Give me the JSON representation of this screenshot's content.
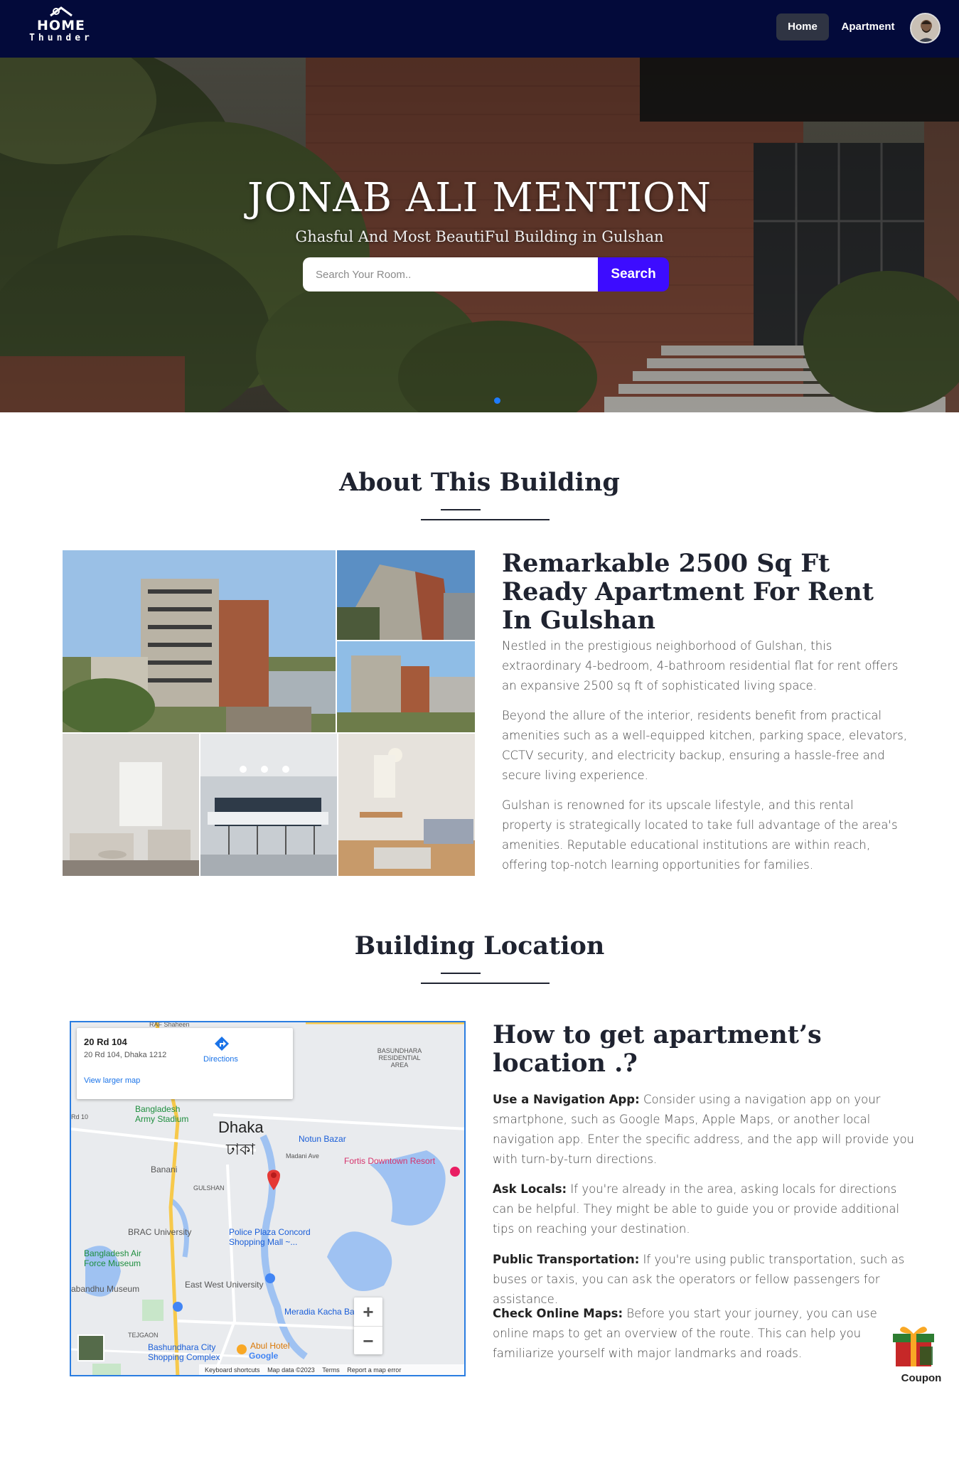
{
  "brand": {
    "logo_word": "HOME",
    "logo_sub": "Thunder"
  },
  "nav": {
    "home_label": "Home",
    "apartment_label": "Apartment"
  },
  "hero": {
    "title": "JONAB ALI MENTION",
    "subtitle": "Ghasful And Most BeautiFul Building in Gulshan",
    "search_placeholder": "Search Your Room..",
    "search_button": "Search",
    "carousel_active_index": 1,
    "carousel_count": 1
  },
  "about": {
    "section_title": "About This Building",
    "heading": "Remarkable 2500 Sq Ft Ready Apartment For Rent In Gulshan",
    "paragraphs": [
      "Nestled in the prestigious neighborhood of Gulshan, this extraordinary 4-bedroom, 4-bathroom residential flat for rent offers an expansive 2500 sq ft of sophisticated living space.",
      "Beyond the allure of the interior, residents benefit from practical amenities such as a well-equipped kitchen, parking space, elevators, CCTV security, and electricity backup, ensuring a hassle-free and secure living experience.",
      "Gulshan is renowned for its upscale lifestyle, and this rental property is strategically located to take full advantage of the area's amenities. Reputable educational institutions are within reach, offering top-notch learning opportunities for families."
    ]
  },
  "location": {
    "section_title": "Building Location",
    "heading": "How to get apartment’s location .?",
    "items": [
      {
        "label": "Use a Navigation App:",
        "text": " Consider using a navigation app on your smartphone, such as Google Maps, Apple Maps, or another local navigation app. Enter the specific address, and the app will provide you with turn-by-turn directions."
      },
      {
        "label": "Ask Locals:",
        "text": " If you're already in the area, asking locals for directions can be helpful. They might be able to guide you or provide additional tips on reaching your destination."
      },
      {
        "label": "Public Transportation:",
        "text": " If you're using public transportation, such as buses or taxis, you can ask the operators or fellow passengers for assistance."
      },
      {
        "label": "Check Online Maps:",
        "text": " Before you start your journey, you can use online maps to get an overview of the route. This can help you familiarize yourself with major landmarks and roads."
      }
    ]
  },
  "map": {
    "place_title": "20 Rd 104",
    "place_address": "20 Rd 104, Dhaka 1212",
    "directions_label": "Directions",
    "larger_map_label": "View larger map",
    "zoom_in": "+",
    "zoom_out": "−",
    "footer": {
      "shortcuts": "Keyboard shortcuts",
      "map_data": "Map data ©2023",
      "terms": "Terms",
      "report": "Report a map error"
    },
    "labels": {
      "top": "RAF Shaheen",
      "basundhara": "BASUNDHARA RESIDENTIAL AREA",
      "bd_stadium": "Bangladesh Army Stadium",
      "dhaka": "Dhaka",
      "dhaka_bn": "ঢাকা",
      "notun_bazar": "Notun Bazar",
      "madani_ave": "Madani Ave",
      "fortis": "Fortis Downtown Resort",
      "banani": "Banani",
      "gulshan": "GULSHAN",
      "brac": "BRAC University",
      "police_plaza": "Police Plaza Concord Shopping Mall ~...",
      "air_force": "Bangladesh Air Force Museum",
      "bangabandhu": "abandhu Museum",
      "east_west": "East West University",
      "meradia": "Meradia Kacha Bazar",
      "tejgaon": "TEJGAON",
      "bashundhara_city": "Bashundhara City Shopping Complex",
      "abul_hotel": "Abul Hotel",
      "google": "Google",
      "road_10": "Rd 10"
    }
  },
  "coupon": {
    "label": "Coupon"
  }
}
